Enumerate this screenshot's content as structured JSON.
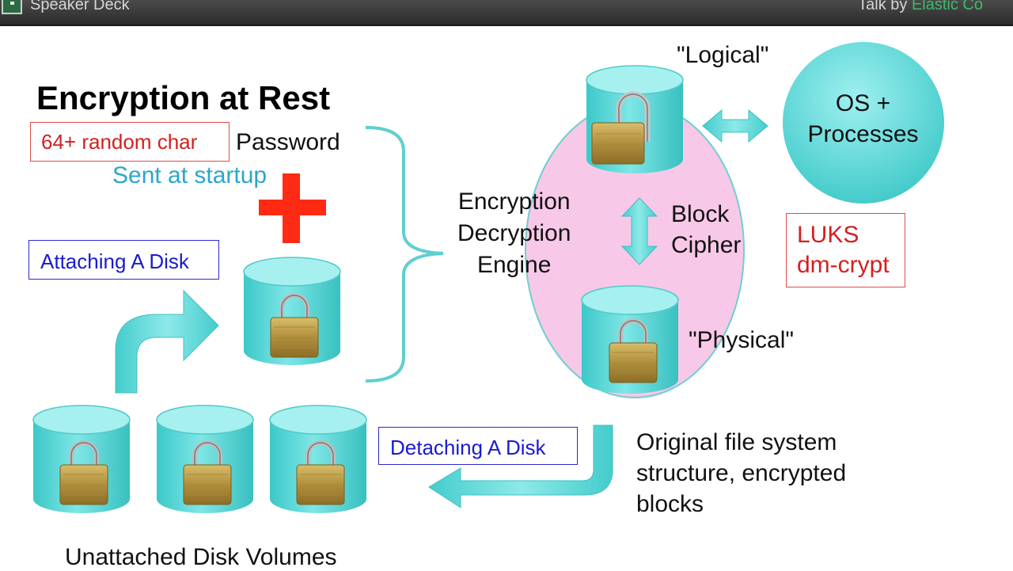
{
  "topbar": {
    "brand": "Speaker Deck",
    "talk_prefix": "Talk by",
    "author": "Elastic Co"
  },
  "slide": {
    "title": "Encryption at Rest",
    "random_char_box": "64+ random char",
    "password_label": "Password",
    "sent_at_startup": "Sent at startup",
    "attaching_disk": "Attaching A Disk",
    "engine_lines": [
      "Encryption",
      "Decryption",
      "Engine"
    ],
    "block_cipher_lines": [
      "Block",
      "Cipher"
    ],
    "logical_label": "\"Logical\"",
    "physical_label": "\"Physical\"",
    "luks_lines": [
      "LUKS",
      "dm-crypt"
    ],
    "os_lines": [
      "OS +",
      "Processes"
    ],
    "detaching_disk": "Detaching A Disk",
    "original_lines": [
      "Original file system",
      "structure, encrypted",
      "blocks"
    ],
    "unattached_label": "Unattached Disk Volumes"
  },
  "colors": {
    "cylinder": "#5fd9d9",
    "cylinder_top": "#a8f0f0",
    "arrow": "#5fd9d9",
    "ellipse": "#f7c6e6",
    "red_plus": "#ff2a14",
    "lock_body": "#b8963c"
  }
}
